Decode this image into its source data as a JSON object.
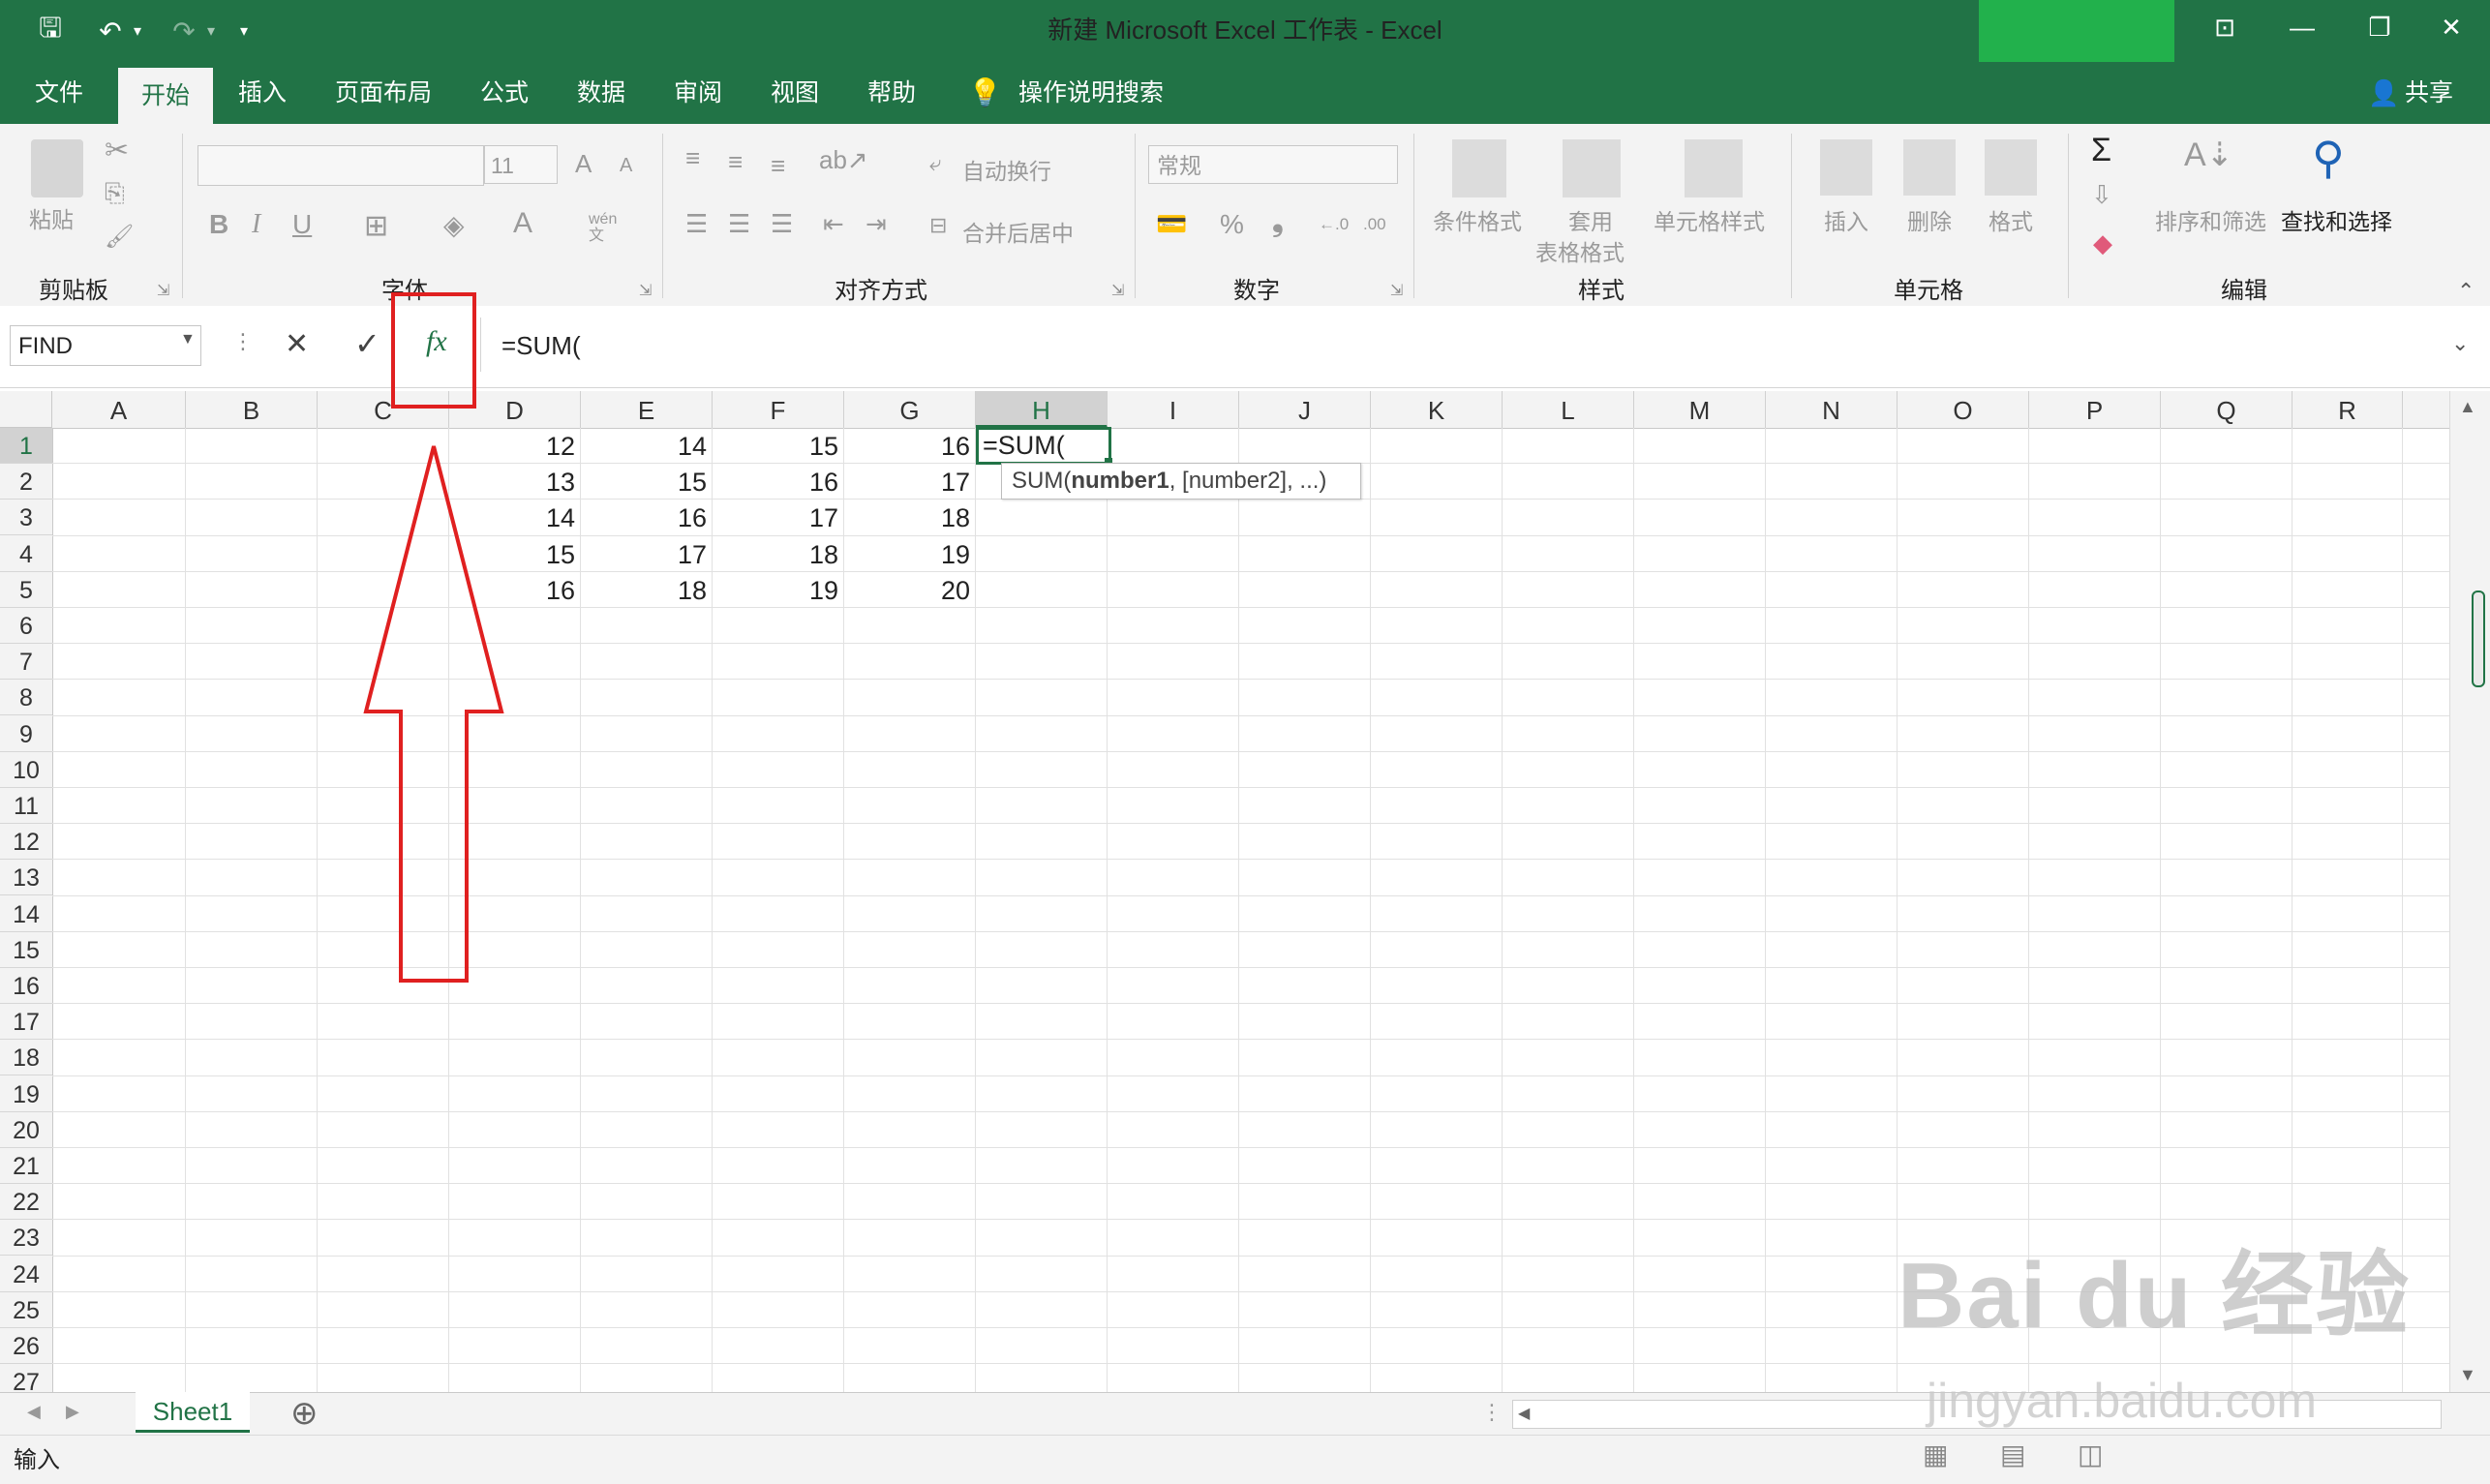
{
  "window": {
    "title": "新建 Microsoft Excel 工作表  -  Excel",
    "minimize_icon": "—",
    "restore_icon": "❐",
    "close_icon": "✕",
    "ribbon_display_icon": "⊡"
  },
  "tabs": [
    {
      "label": "文件"
    },
    {
      "label": "开始"
    },
    {
      "label": "插入"
    },
    {
      "label": "页面布局"
    },
    {
      "label": "公式"
    },
    {
      "label": "数据"
    },
    {
      "label": "审阅"
    },
    {
      "label": "视图"
    },
    {
      "label": "帮助"
    },
    {
      "label": "操作说明搜索"
    }
  ],
  "share_label": "共享",
  "ribbon": {
    "clipboard": {
      "paste_label": "粘贴",
      "group_label": "剪贴板"
    },
    "font": {
      "font_size": "11",
      "bold": "B",
      "italic": "I",
      "underline": "U",
      "group_label": "字体",
      "grow": "A",
      "shrink": "A",
      "font_color": "A",
      "wen": "wén文"
    },
    "alignment": {
      "wrap_text": "自动换行",
      "merge_center": "合并后居中",
      "group_label": "对齐方式"
    },
    "number": {
      "format": "常规",
      "percent": "%",
      "comma": "❟",
      "inc_decimal": "←.0",
      "dec_decimal": ".00",
      "group_label": "数字"
    },
    "styles": {
      "conditional": "条件格式",
      "table_line1": "套用",
      "table_line2": "表格格式",
      "cell_styles": "单元格样式",
      "group_label": "样式"
    },
    "cells": {
      "insert": "插入",
      "delete": "删除",
      "format": "格式",
      "group_label": "单元格"
    },
    "editing": {
      "sum_icon": "Σ",
      "sort_filter": "排序和筛选",
      "find_select": "查找和选择",
      "group_label": "编辑"
    }
  },
  "formula_bar": {
    "name_box": "FIND",
    "cancel_icon": "✕",
    "enter_icon": "✓",
    "fx_label": "fx",
    "formula": "=SUM("
  },
  "columns": [
    "A",
    "B",
    "C",
    "D",
    "E",
    "F",
    "G",
    "H",
    "I",
    "J",
    "K",
    "L",
    "M",
    "N",
    "O",
    "P",
    "Q",
    "R"
  ],
  "rows": [
    "1",
    "2",
    "3",
    "4",
    "5",
    "6",
    "7",
    "8",
    "9",
    "10",
    "11",
    "12",
    "13",
    "14",
    "15",
    "16",
    "17",
    "18",
    "19",
    "20",
    "21",
    "22",
    "23",
    "24",
    "25",
    "26",
    "27"
  ],
  "cells": [
    [
      "12",
      "14",
      "15",
      "16"
    ],
    [
      "13",
      "15",
      "16",
      "17"
    ],
    [
      "14",
      "16",
      "17",
      "18"
    ],
    [
      "15",
      "17",
      "18",
      "19"
    ],
    [
      "16",
      "18",
      "19",
      "20"
    ]
  ],
  "active_cell": {
    "ref": "H1",
    "text": "=SUM("
  },
  "tooltip": {
    "fn": "SUM(",
    "arg1": "number1",
    "rest": ", [number2], ...)"
  },
  "sheet": {
    "name": "Sheet1",
    "add_icon": "⊕"
  },
  "status": {
    "mode": "输入"
  },
  "watermark": {
    "brand": "Bai du 经验",
    "url": "jingyan.baidu.com"
  }
}
